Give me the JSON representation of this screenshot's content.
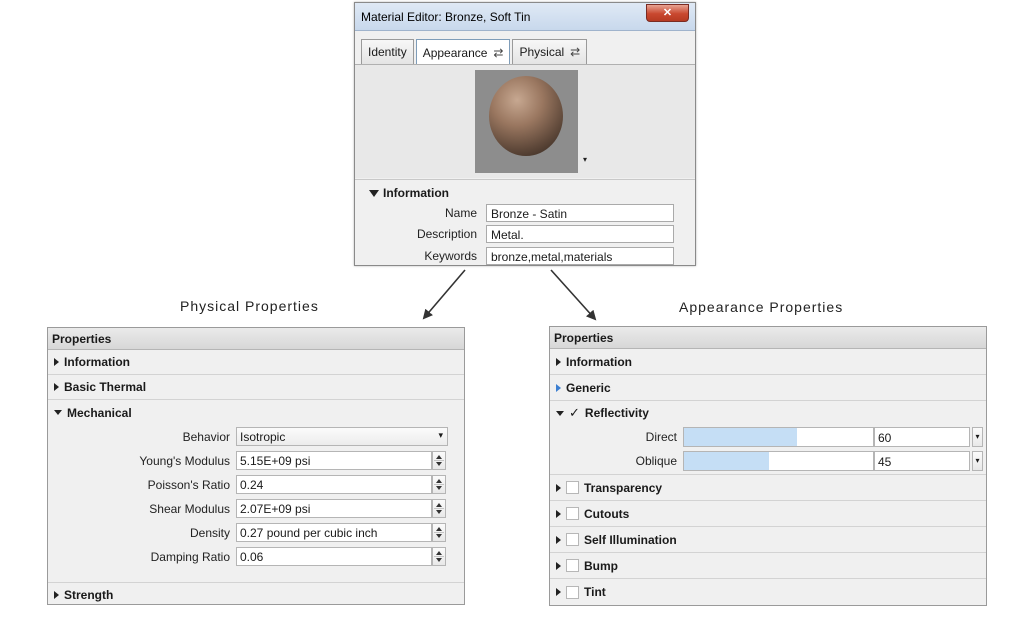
{
  "window": {
    "title": "Material Editor: Bronze, Soft Tin",
    "close_glyph": "✕",
    "tabs": [
      {
        "label": "Identity",
        "sync": ""
      },
      {
        "label": "Appearance",
        "sync": "⇄"
      },
      {
        "label": "Physical",
        "sync": "⇄"
      }
    ],
    "swatch_menu": "▾",
    "info": {
      "title": "Information",
      "fields": [
        {
          "label": "Name",
          "value": "Bronze - Satin"
        },
        {
          "label": "Description",
          "value": "Metal."
        },
        {
          "label": "Keywords",
          "value": "bronze,metal,materials"
        }
      ]
    }
  },
  "captions": {
    "physical": "Physical Properties",
    "appearance": "Appearance Properties"
  },
  "physical_panel": {
    "header": "Properties",
    "sections_before": [
      "Information",
      "Basic Thermal"
    ],
    "mechanical": {
      "title": "Mechanical",
      "behavior": {
        "label": "Behavior",
        "value": "Isotropic"
      },
      "rows": [
        {
          "label": "Young's Modulus",
          "value": "5.15E+09 psi"
        },
        {
          "label": "Poisson's Ratio",
          "value": "0.24"
        },
        {
          "label": "Shear Modulus",
          "value": "2.07E+09 psi"
        },
        {
          "label": "Density",
          "value": "0.27 pound per cubic inch"
        },
        {
          "label": "Damping Ratio",
          "value": "0.06"
        }
      ]
    },
    "sections_after": [
      "Strength"
    ]
  },
  "appearance_panel": {
    "header": "Properties",
    "information": "Information",
    "generic": "Generic",
    "reflectivity": {
      "title": "Reflectivity",
      "check": "✓",
      "rows": [
        {
          "label": "Direct",
          "value": "60",
          "fill_percent": 60
        },
        {
          "label": "Oblique",
          "value": "45",
          "fill_percent": 45
        }
      ]
    },
    "checkbox_sections": [
      "Transparency",
      "Cutouts",
      "Self Illumination",
      "Bump",
      "Tint"
    ]
  },
  "colors": {
    "slider_fill": "#c5def5",
    "generic_arrow": "#3c7fd1",
    "close_button": "#c9482f"
  }
}
